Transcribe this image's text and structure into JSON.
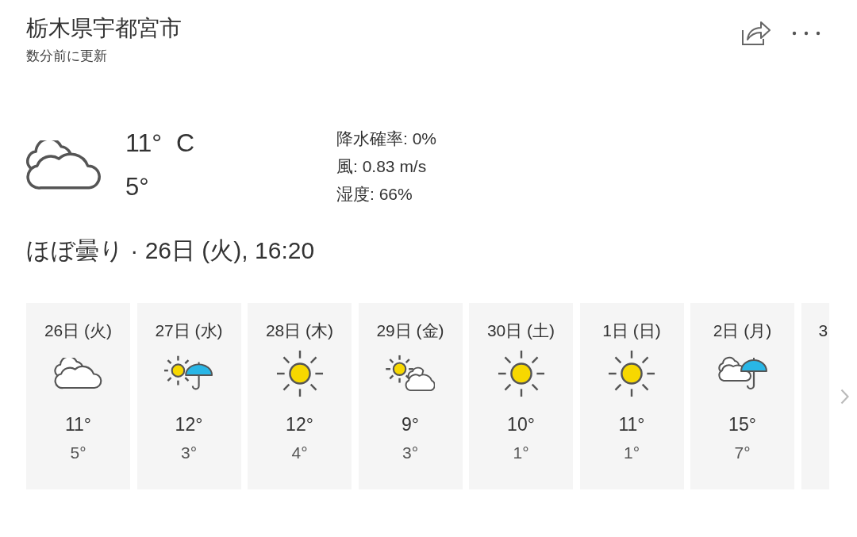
{
  "location": {
    "title": "栃木県宇都宮市",
    "updated": "数分前に更新"
  },
  "current": {
    "kind": "cloudy",
    "high": "11°",
    "unit": "C",
    "low": "5°",
    "details": [
      "降水確率: 0%",
      "風: 0.83 m/s",
      "湿度: 66%"
    ],
    "summary": "ほぼ曇り · 26日 (火), 16:20"
  },
  "forecast": [
    {
      "date": "26日 (火)",
      "kind": "cloudy",
      "high": "11°",
      "low": "5°"
    },
    {
      "date": "27日 (水)",
      "kind": "sun-umbrella",
      "high": "12°",
      "low": "3°"
    },
    {
      "date": "28日 (木)",
      "kind": "sunny",
      "high": "12°",
      "low": "4°"
    },
    {
      "date": "29日 (金)",
      "kind": "sun-cloud",
      "high": "9°",
      "low": "3°"
    },
    {
      "date": "30日 (土)",
      "kind": "sunny",
      "high": "10°",
      "low": "1°"
    },
    {
      "date": "1日 (日)",
      "kind": "sunny",
      "high": "11°",
      "low": "1°"
    },
    {
      "date": "2日 (月)",
      "kind": "cloud-umbrella",
      "high": "15°",
      "low": "7°"
    },
    {
      "date": "3",
      "kind": "partial"
    }
  ]
}
